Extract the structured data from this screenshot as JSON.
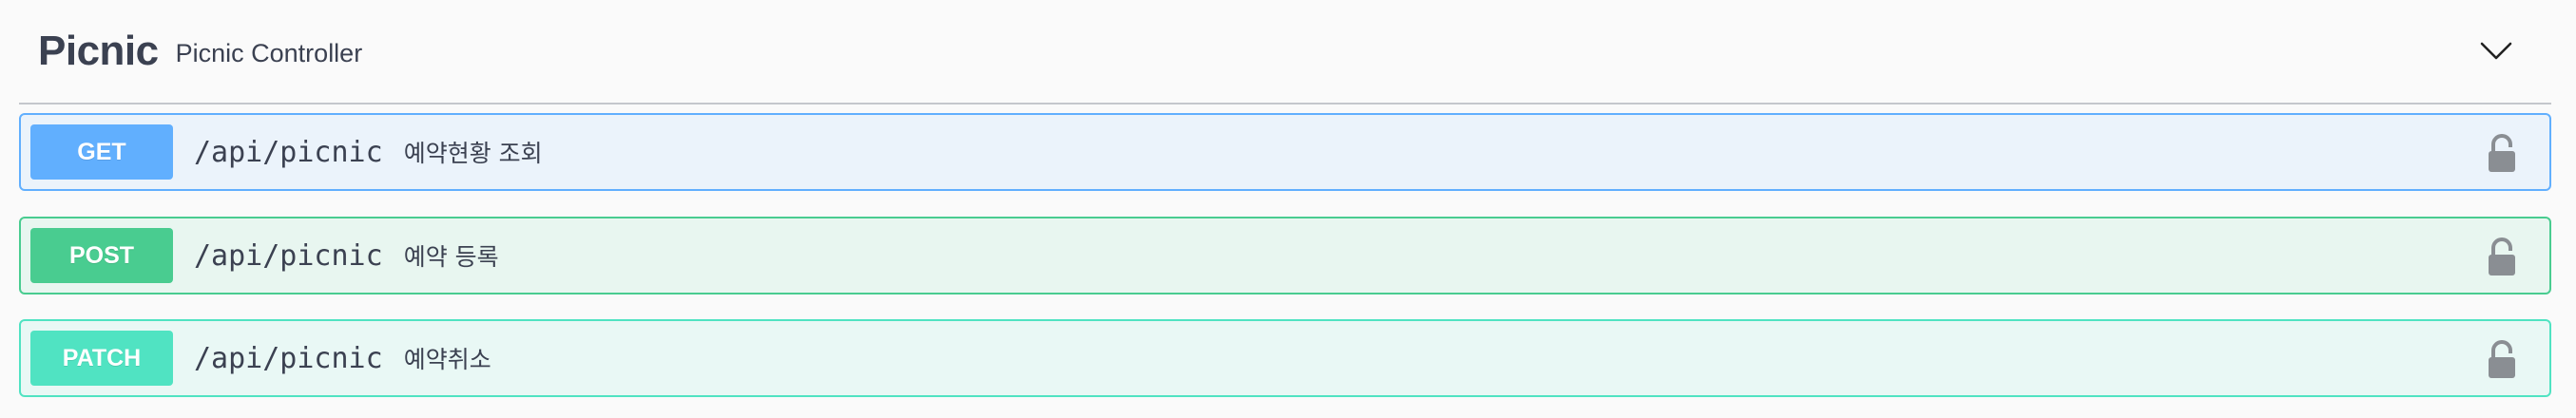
{
  "tag": {
    "name": "Picnic",
    "description": "Picnic Controller",
    "toggle_icon": "chevron-down-icon"
  },
  "operations": [
    {
      "method": "GET",
      "path": "/api/picnic",
      "summary": "예약현황 조회",
      "color": "#61affe",
      "lock_icon": "lock-icon"
    },
    {
      "method": "POST",
      "path": "/api/picnic",
      "summary": "예약 등록",
      "color": "#49cc90",
      "lock_icon": "lock-icon"
    },
    {
      "method": "PATCH",
      "path": "/api/picnic",
      "summary": "예약취소",
      "color": "#50e3c2",
      "lock_icon": "lock-icon"
    }
  ]
}
